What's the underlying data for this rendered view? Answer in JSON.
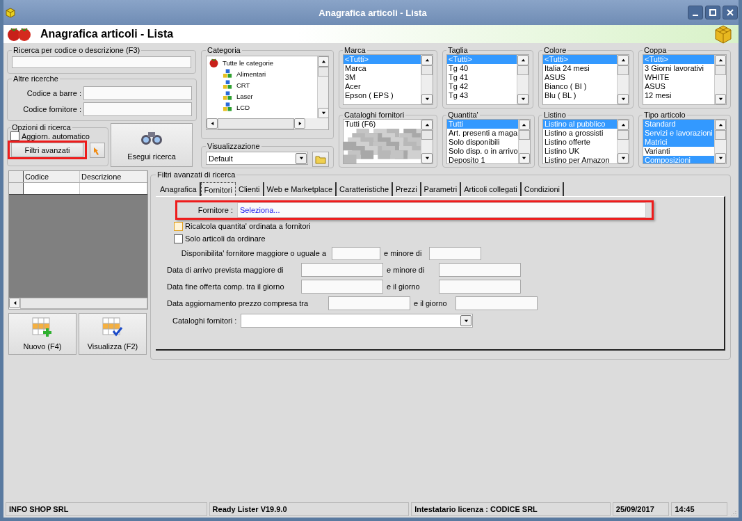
{
  "window": {
    "title": "Anagrafica articoli  - Lista"
  },
  "header": {
    "title": "Anagrafica articoli  - Lista"
  },
  "search": {
    "label": "Ricerca per codice o descrizione (F3)"
  },
  "other_searches": {
    "label": "Altre ricerche",
    "fields": [
      {
        "label": "Codice a barre :"
      },
      {
        "label": "Codice fornitore :"
      }
    ]
  },
  "search_options": {
    "label": "Opzioni di ricerca",
    "auto_update": {
      "label": "Aggiorn. automatico",
      "checked": false
    },
    "advanced_button": {
      "label": "Filtri avanzati",
      "highlighted": true
    }
  },
  "run_button": "Esegui ricerca",
  "category": {
    "label": "Categoria",
    "tree": [
      {
        "label": "Tutte le categorie",
        "children": [
          {
            "label": "Alimentari"
          },
          {
            "label": "CRT"
          },
          {
            "label": "Laser"
          },
          {
            "label": "LCD"
          }
        ]
      }
    ]
  },
  "view": {
    "label": "Visualizzazione",
    "value": "Default"
  },
  "lists": [
    {
      "label": "Marca",
      "redacted": false,
      "items": [
        {
          "label": "<Tutti>",
          "selected": true
        },
        {
          "label": "Marca",
          "selected": false
        },
        {
          "label": "3M",
          "selected": false
        },
        {
          "label": "Acer",
          "selected": false
        },
        {
          "label": "Epson ( EPS )",
          "selected": false
        }
      ]
    },
    {
      "label": "Taglia",
      "redacted": false,
      "items": [
        {
          "label": "<Tutti>",
          "selected": true
        },
        {
          "label": "Tg 40",
          "selected": false
        },
        {
          "label": "Tg 41",
          "selected": false
        },
        {
          "label": "Tg 42",
          "selected": false
        },
        {
          "label": "Tg 43",
          "selected": false
        }
      ]
    },
    {
      "label": "Colore",
      "redacted": false,
      "items": [
        {
          "label": "<Tutti>",
          "selected": true
        },
        {
          "label": "Italia 24 mesi",
          "selected": false
        },
        {
          "label": "ASUS",
          "selected": false
        },
        {
          "label": "Bianco ( BI )",
          "selected": false
        },
        {
          "label": "Blu ( BL )",
          "selected": false
        }
      ]
    },
    {
      "label": "Coppa",
      "redacted": false,
      "items": [
        {
          "label": "<Tutti>",
          "selected": true
        },
        {
          "label": "3 Giorni lavorativi",
          "selected": false
        },
        {
          "label": "WHITE",
          "selected": false
        },
        {
          "label": "ASUS",
          "selected": false
        },
        {
          "label": "12 mesi",
          "selected": false
        }
      ]
    },
    {
      "label": "Cataloghi fornitori",
      "redacted": true,
      "items": [
        {
          "label": "Tutti (F6)",
          "selected": false
        }
      ]
    },
    {
      "label": "Quantita'",
      "redacted": false,
      "items": [
        {
          "label": "Tutti",
          "selected": true
        },
        {
          "label": "Art. presenti a maga",
          "selected": false
        },
        {
          "label": "Solo disponibili",
          "selected": false
        },
        {
          "label": "Solo disp. o in arrivo",
          "selected": false
        },
        {
          "label": "Deposito 1",
          "selected": false
        }
      ]
    },
    {
      "label": "Listino",
      "redacted": false,
      "items": [
        {
          "label": "Listino al pubblico",
          "selected": true
        },
        {
          "label": "Listino a grossisti",
          "selected": false
        },
        {
          "label": "Listino offerte",
          "selected": false
        },
        {
          "label": "Listino UK",
          "selected": false
        },
        {
          "label": "Listino per Amazon",
          "selected": false
        }
      ]
    },
    {
      "label": "Tipo articolo",
      "redacted": false,
      "items": [
        {
          "label": "Standard",
          "selected": true
        },
        {
          "label": "Servizi e lavorazioni",
          "selected": true
        },
        {
          "label": "Matrici",
          "selected": true
        },
        {
          "label": "Varianti",
          "selected": false
        },
        {
          "label": "Composizioni",
          "selected": true
        }
      ]
    }
  ],
  "grid": {
    "columns": [
      "Codice",
      "Descrizione"
    ]
  },
  "buttons": [
    {
      "label": "Nuovo (F4)",
      "kind": "new"
    },
    {
      "label": "Visualizza (F2)",
      "kind": "view"
    }
  ],
  "advanced": {
    "label": "Filtri avanzati di ricerca",
    "tabs": [
      {
        "label": "Anagrafica",
        "selected": false
      },
      {
        "label": "Fornitori",
        "selected": true
      },
      {
        "label": "Clienti",
        "selected": false
      },
      {
        "label": "Web e Marketplace",
        "selected": false
      },
      {
        "label": "Caratteristiche",
        "selected": false
      },
      {
        "label": "Prezzi",
        "selected": false
      },
      {
        "label": "Parametri",
        "selected": false
      },
      {
        "label": "Articoli collegati",
        "selected": false
      },
      {
        "label": "Condizioni",
        "selected": false
      }
    ],
    "supplier": {
      "label": "Fornitore :",
      "value": "Seleziona...",
      "highlighted": true
    },
    "checkboxes": [
      {
        "label": "Ricalcola quantita' ordinata a fornitori",
        "checked": false
      },
      {
        "label": "Solo articoli da ordinare",
        "checked": false
      }
    ],
    "ranges": [
      {
        "label": "Disponibilita' fornitore maggiore o uguale a",
        "and_label": "e minore di"
      },
      {
        "label": "Data di arrivo prevista maggiore di",
        "and_label": "e minore di"
      },
      {
        "label": "Data fine offerta comp. tra il giorno",
        "and_label": "e il giorno"
      },
      {
        "label": "Data aggiornamento prezzo compresa tra",
        "and_label": "e il giorno"
      }
    ],
    "catalog": {
      "label": "Cataloghi fornitori :"
    }
  },
  "status_bar": [
    "INFO SHOP SRL",
    "Ready Lister V19.9.0",
    "Intestatario licenza : CODICE SRL",
    "25/09/2017",
    "14:45"
  ]
}
